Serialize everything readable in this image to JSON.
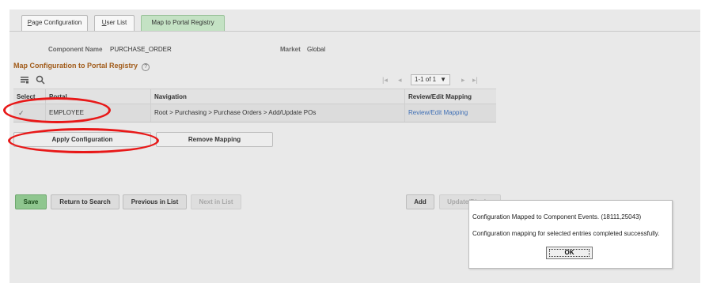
{
  "tabs": [
    {
      "prefix": "",
      "underlined": "P",
      "rest": "age Configuration"
    },
    {
      "prefix": "",
      "underlined": "U",
      "rest": "ser List"
    },
    {
      "prefix": "",
      "underlined": "",
      "rest": "Map to Portal Registry"
    }
  ],
  "header": {
    "component_label": "Component Name",
    "component_value": "PURCHASE_ORDER",
    "market_label": "Market",
    "market_value": "Global"
  },
  "section": {
    "title": "Map Configuration to Portal Registry",
    "help_icon": "?"
  },
  "grid": {
    "toolbar_icons": [
      "personalize-grid-icon",
      "find-icon"
    ],
    "pager": {
      "first": "|◂",
      "prev": "◂",
      "range": "1-1 of 1",
      "next": "▸",
      "last": "▸|"
    },
    "columns": [
      "Select",
      "Portal",
      "Navigation",
      "Review/Edit Mapping"
    ],
    "rows": [
      {
        "selected": true,
        "portal": "EMPLOYEE",
        "navigation": "Root > Purchasing > Purchase Orders > Add/Update POs",
        "link": "Review/Edit Mapping"
      }
    ]
  },
  "actions": {
    "apply": "Apply Configuration",
    "remove": "Remove Mapping"
  },
  "footer": {
    "save": "Save",
    "return": "Return to Search",
    "previous": "Previous in List",
    "next": "Next in List",
    "add": "Add",
    "update": "Update/Display"
  },
  "dialog": {
    "line1": "Configuration Mapped to Component Events. (18111,25043)",
    "line2": "Configuration mapping for selected entries completed successfully.",
    "ok": "OK"
  },
  "colors": {
    "active_tab": "#c4e2c4",
    "section_title": "#a15b19",
    "link": "#3f6fb5",
    "save_button": "#8fc68f",
    "annotation": "#e81818"
  }
}
